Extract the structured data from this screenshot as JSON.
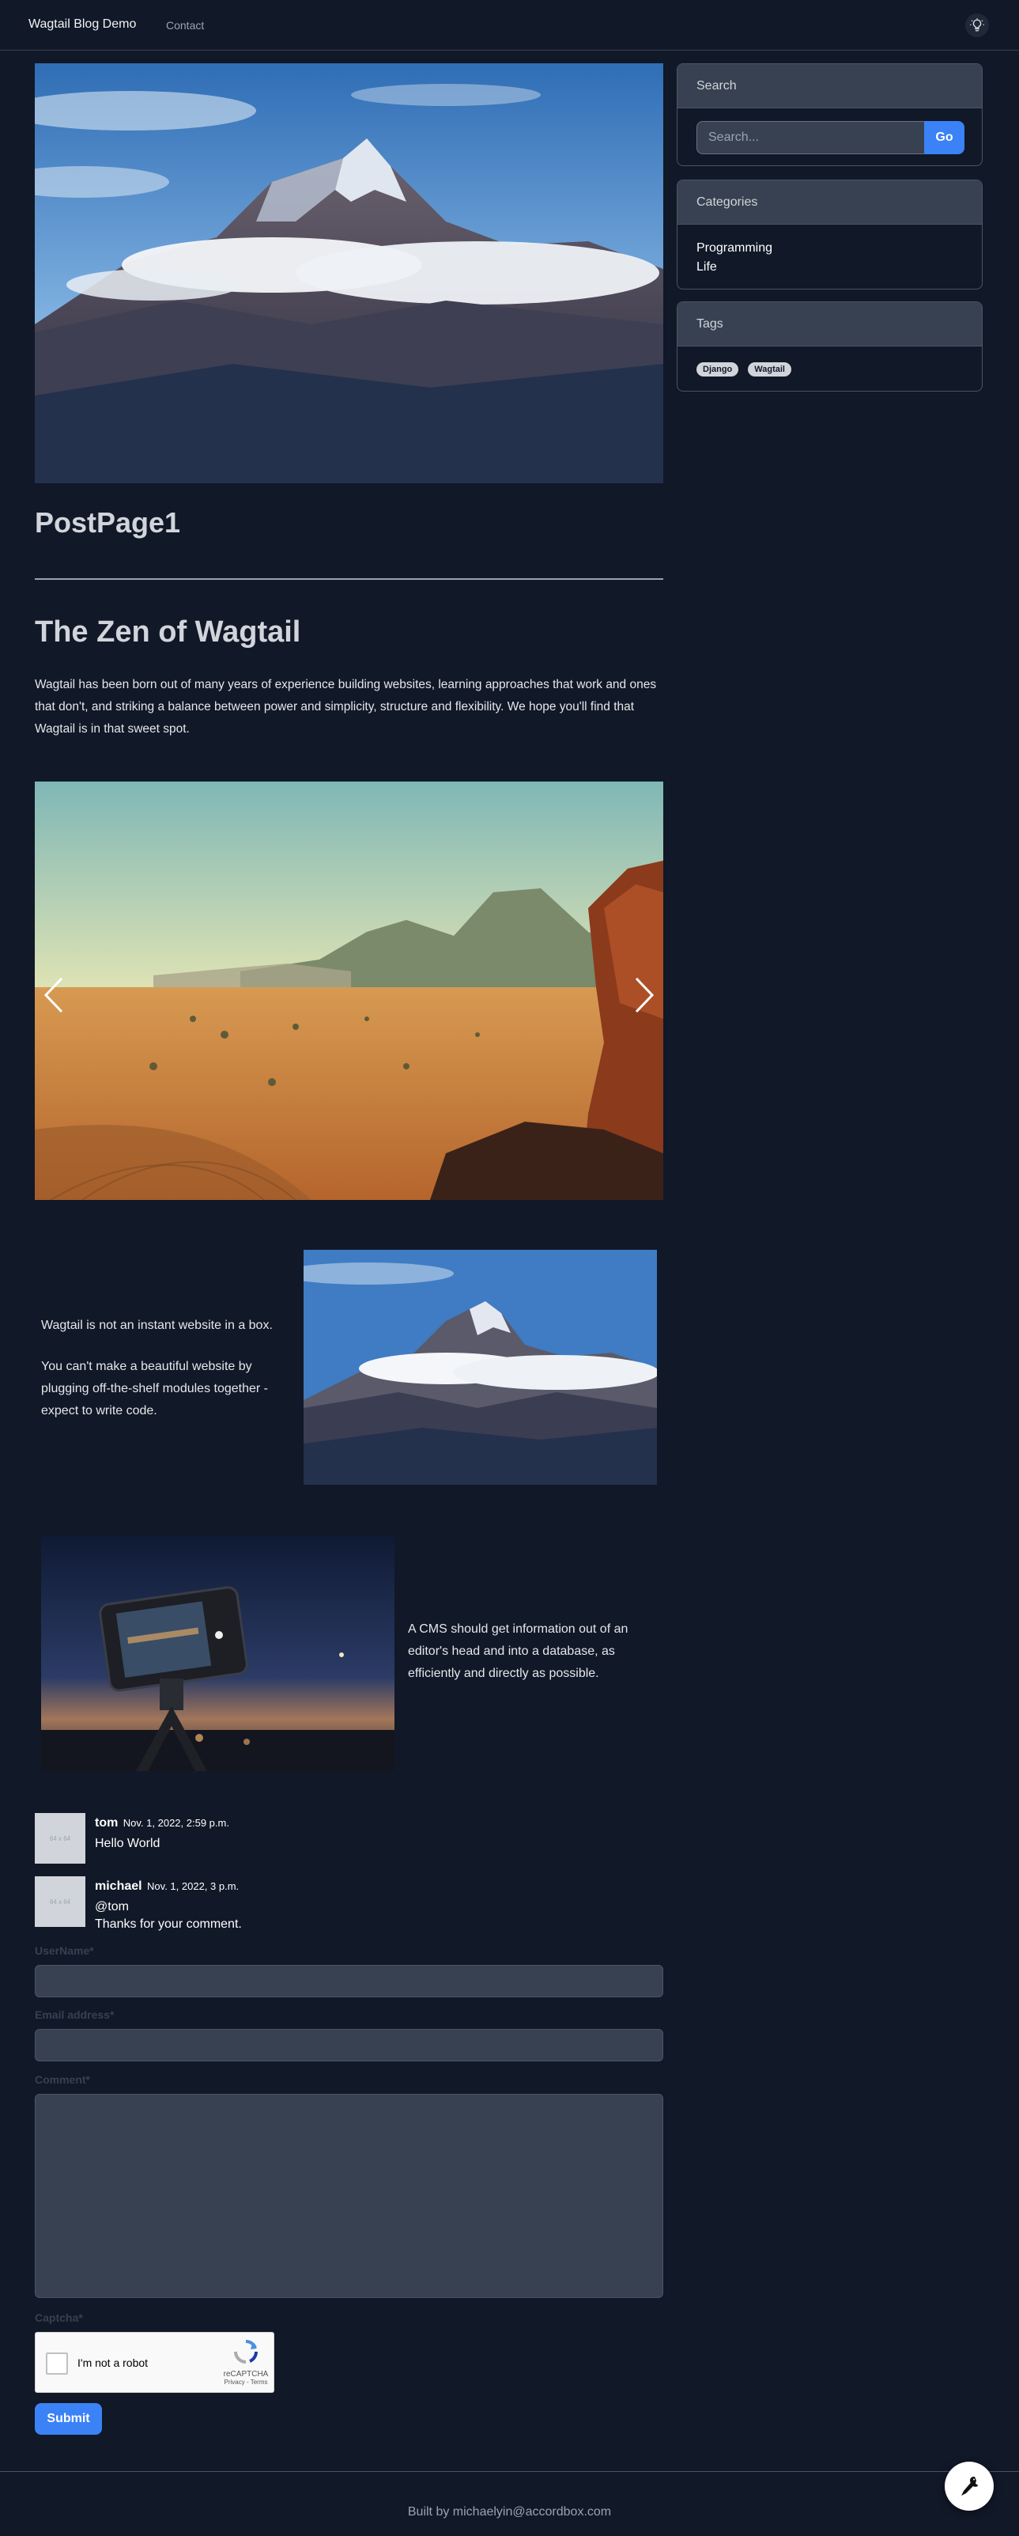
{
  "nav": {
    "brand": "Wagtail Blog Demo",
    "links": [
      {
        "label": "Contact"
      }
    ],
    "theme_icon": "lightbulb-icon"
  },
  "post": {
    "hero_image": "mountain-peak-photo",
    "title": "PostPage1",
    "heading": "The Zen of Wagtail",
    "intro": "Wagtail has been born out of many years of experience building websites, learning approaches that work and ones that don't, and striking a balance between power and simplicity, structure and flexibility. We hope you'll find that Wagtail is in that sweet spot.",
    "carousel": {
      "image": "desert-landscape-photo",
      "prev_icon": "chevron-left-icon",
      "next_icon": "chevron-right-icon"
    },
    "block1": {
      "paragraphs": [
        "Wagtail is not an instant website in a box.",
        "You can't make a beautiful website by plugging off-the-shelf modules together - expect to write code."
      ],
      "image": "mountain-peak-photo"
    },
    "block2": {
      "image": "phone-on-tripod-photo",
      "text": "A CMS should get information out of an editor's head and into a database, as efficiently and directly as possible."
    }
  },
  "comments": [
    {
      "author": "tom",
      "date": "Nov. 1, 2022, 2:59 p.m.",
      "lines": [
        "Hello World"
      ],
      "avatar_text": "64 x 64"
    },
    {
      "author": "michael",
      "date": "Nov. 1, 2022, 3 p.m.",
      "lines": [
        "@tom",
        "Thanks for your comment."
      ],
      "avatar_text": "64 x 64"
    }
  ],
  "form": {
    "username_label": "UserName*",
    "email_label": "Email address*",
    "comment_label": "Comment*",
    "captcha_label": "Captcha*",
    "captcha": {
      "checkbox_label": "I'm not a robot",
      "brand": "reCAPTCHA",
      "links": "Privacy - Terms"
    },
    "submit_label": "Submit"
  },
  "sidebar": {
    "search": {
      "title": "Search",
      "placeholder": "Search...",
      "button": "Go"
    },
    "categories": {
      "title": "Categories",
      "items": [
        "Programming",
        "Life"
      ]
    },
    "tags": {
      "title": "Tags",
      "items": [
        "Django",
        "Wagtail"
      ]
    }
  },
  "footer": {
    "text": "Built by michaelyin@accordbox.com",
    "userbar_icon": "wagtail-bird-icon"
  }
}
